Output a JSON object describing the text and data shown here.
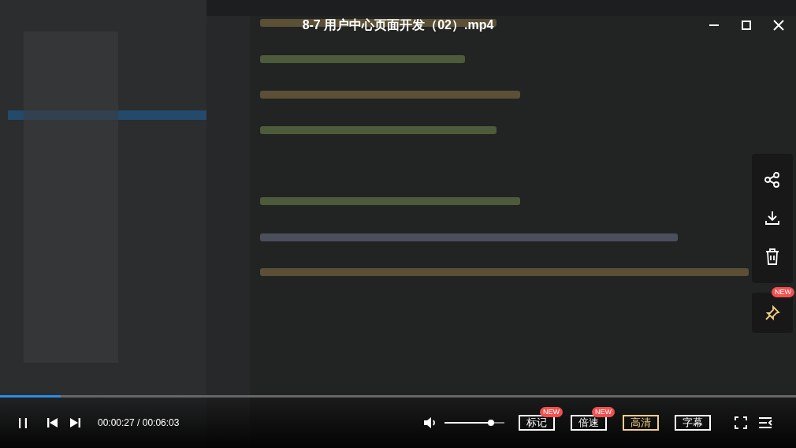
{
  "title": "8-7 用户中心页面开发（02）.mp4",
  "side_actions": {
    "pin_badge": "NEW"
  },
  "progress": {
    "level": 0.076
  },
  "playing": true,
  "time": "00:00:27 / 00:06:03",
  "volume": {
    "level": 0.78
  },
  "buttons": [
    {
      "label": "标记",
      "badge": "NEW",
      "selected": false
    },
    {
      "label": "倍速",
      "badge": "NEW",
      "selected": false
    },
    {
      "label": "高清",
      "selected": true
    },
    {
      "label": "字幕",
      "selected": false
    }
  ]
}
